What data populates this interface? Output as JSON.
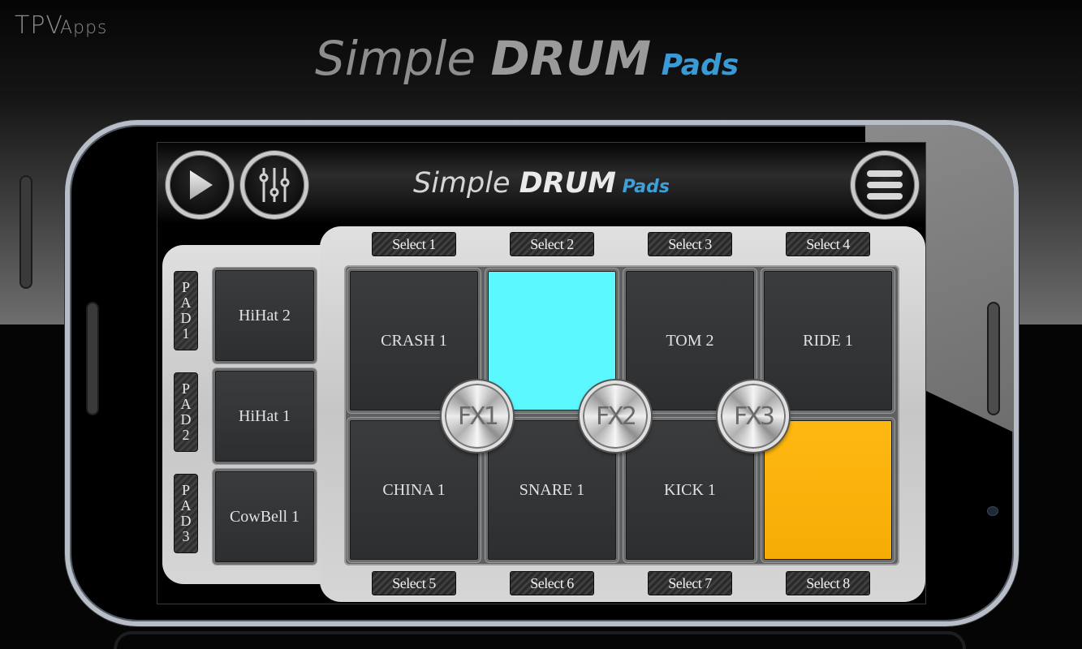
{
  "brand": {
    "main": "TPV",
    "suffix": "Apps"
  },
  "hero_title": {
    "part1": "Simple ",
    "part2": "DRUM",
    "part3": " Pads"
  },
  "app": {
    "title": {
      "part1": "Simple ",
      "part2": "DRUM",
      "part3": " Pads"
    },
    "buttons": {
      "play_icon": "play-icon",
      "mixer_icon": "mixer-sliders-icon",
      "menu_icon": "hamburger-menu-icon"
    },
    "side_pads": [
      {
        "tag": [
          "P",
          "A",
          "D",
          "1"
        ],
        "label": "HiHat 2"
      },
      {
        "tag": [
          "P",
          "A",
          "D",
          "2"
        ],
        "label": "HiHat 1"
      },
      {
        "tag": [
          "P",
          "A",
          "D",
          "3"
        ],
        "label": "CowBell 1"
      }
    ],
    "select_top": [
      "Select 1",
      "Select 2",
      "Select 3",
      "Select 4"
    ],
    "select_bottom": [
      "Select 5",
      "Select 6",
      "Select 7",
      "Select 8"
    ],
    "pads": [
      {
        "label": "CRASH 1",
        "state": "idle"
      },
      {
        "label": "",
        "state": "active",
        "color": "#5cf8ff"
      },
      {
        "label": "TOM 2",
        "state": "idle"
      },
      {
        "label": "RIDE 1",
        "state": "idle"
      },
      {
        "label": "CHINA 1",
        "state": "idle"
      },
      {
        "label": "SNARE 1",
        "state": "idle"
      },
      {
        "label": "KICK 1",
        "state": "idle"
      },
      {
        "label": "",
        "state": "active",
        "color": "#ffb812"
      }
    ],
    "fx": [
      "FX1",
      "FX2",
      "FX3"
    ]
  },
  "colors": {
    "accent_blue": "#3a9ad6",
    "pad_cyan": "#5cf8ff",
    "pad_amber": "#ffb812"
  }
}
